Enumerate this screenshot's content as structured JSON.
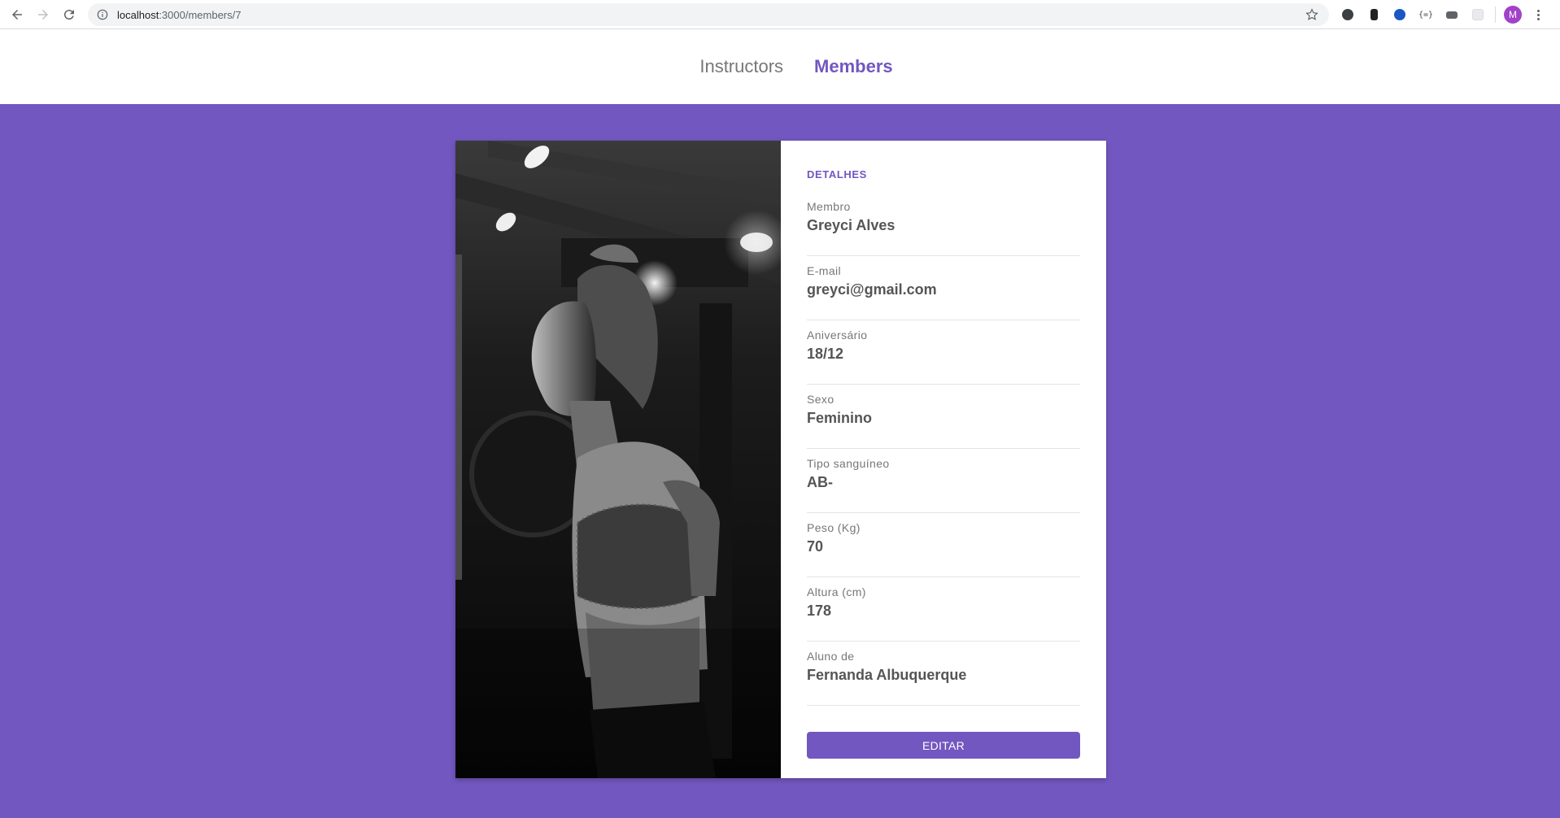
{
  "browser": {
    "url_host": "localhost",
    "url_path": ":3000/members/7",
    "profile_initial": "M"
  },
  "nav": {
    "links": [
      {
        "label": "Instructors",
        "active": false
      },
      {
        "label": "Members",
        "active": true
      }
    ]
  },
  "details": {
    "title": "DETALHES",
    "fields": [
      {
        "label": "Membro",
        "value": "Greyci Alves"
      },
      {
        "label": "E-mail",
        "value": "greyci@gmail.com"
      },
      {
        "label": "Aniversário",
        "value": "18/12"
      },
      {
        "label": "Sexo",
        "value": "Feminino"
      },
      {
        "label": "Tipo sanguíneo",
        "value": "AB-"
      },
      {
        "label": "Peso (Kg)",
        "value": "70"
      },
      {
        "label": "Altura (cm)",
        "value": "178"
      },
      {
        "label": "Aluno de",
        "value": "Fernanda Albuquerque"
      }
    ],
    "edit_label": "EDITAR"
  },
  "colors": {
    "accent": "#7257c0",
    "label": "#777777",
    "value": "#555555"
  }
}
